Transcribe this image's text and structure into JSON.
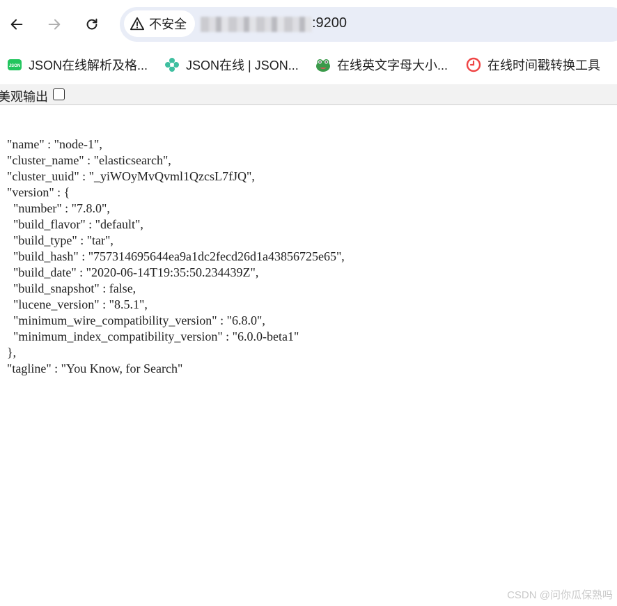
{
  "browser": {
    "security_label": "不安全",
    "url_suffix": ":9200",
    "icons": {
      "back": "back-arrow-icon",
      "forward": "forward-arrow-icon",
      "reload": "reload-icon",
      "warning": "warning-triangle-icon"
    }
  },
  "bookmarks": [
    {
      "label": "JSON在线解析及格...",
      "icon": "json-green-icon"
    },
    {
      "label": "JSON在线 | JSON...",
      "icon": "flower-icon"
    },
    {
      "label": "在线英文字母大小...",
      "icon": "frog-icon"
    },
    {
      "label": "在线时间戳转换工具",
      "icon": "clock-icon"
    }
  ],
  "pretty_print": {
    "label": "美观输出",
    "checked": false
  },
  "json_lines": [
    "\"name\" : \"node-1\",",
    "\"cluster_name\" : \"elasticsearch\",",
    "\"cluster_uuid\" : \"_yiWOyMvQvml1QzcsL7fJQ\",",
    "\"version\" : {",
    "  \"number\" : \"7.8.0\",",
    "  \"build_flavor\" : \"default\",",
    "  \"build_type\" : \"tar\",",
    "  \"build_hash\" : \"757314695644ea9a1dc2fecd26d1a43856725e65\",",
    "  \"build_date\" : \"2020-06-14T19:35:50.234439Z\",",
    "  \"build_snapshot\" : false,",
    "  \"lucene_version\" : \"8.5.1\",",
    "  \"minimum_wire_compatibility_version\" : \"6.8.0\",",
    "  \"minimum_index_compatibility_version\" : \"6.0.0-beta1\"",
    "},",
    "\"tagline\" : \"You Know, for Search\""
  ],
  "watermark": "CSDN @问你瓜保熟吗",
  "colors": {
    "omnibox": "#e9edf7",
    "json_icon": "#22c55e",
    "flower_icon": "#3fbfa0",
    "clock_icon": "#ef4444"
  }
}
